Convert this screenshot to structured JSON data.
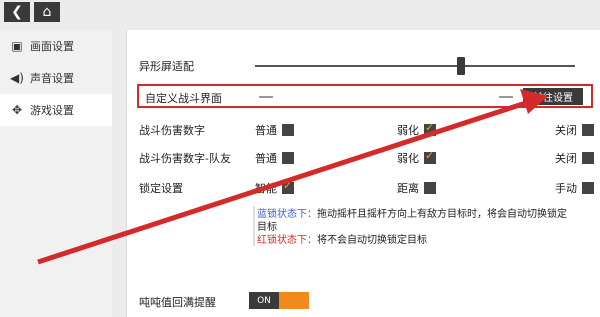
{
  "topbar": {
    "back_icon": "back-arrow-icon",
    "home_icon": "home-icon"
  },
  "sidebar": {
    "items": [
      {
        "label": "画面设置",
        "icon": "display-icon"
      },
      {
        "label": "声音设置",
        "icon": "speaker-icon"
      },
      {
        "label": "游戏设置",
        "icon": "gamepad-icon"
      }
    ]
  },
  "settings": {
    "adaptive_screen": {
      "label": "异形屏适配",
      "value": 0.63
    },
    "custom_battle": {
      "label": "自定义战斗界面",
      "button": "前往设置"
    },
    "damage_numbers": {
      "label": "战斗伤害数字",
      "options": [
        "普通",
        "弱化",
        "关闭"
      ],
      "selected": "弱化"
    },
    "team_damage": {
      "label": "战斗伤害数字-队友",
      "options": [
        "普通",
        "弱化",
        "关闭"
      ],
      "selected": "弱化"
    },
    "lock": {
      "label": "锁定设置",
      "options": [
        "智能",
        "距离",
        "手动"
      ],
      "selected": "智能"
    },
    "tip": {
      "blue_label": "蓝锁状态下：",
      "blue_text": "拖动摇杆且摇杆方向上有敌方目标时，将会自动切换锁定目标",
      "red_label": "红锁状态下：",
      "red_text": "将不会自动切换锁定目标"
    },
    "reminder": {
      "label": "吨吨值回满提醒",
      "toggle": "ON"
    }
  },
  "colors": {
    "highlight": "#d52a2a",
    "accent": "#f08a1c",
    "dark": "#3a3a3a"
  }
}
